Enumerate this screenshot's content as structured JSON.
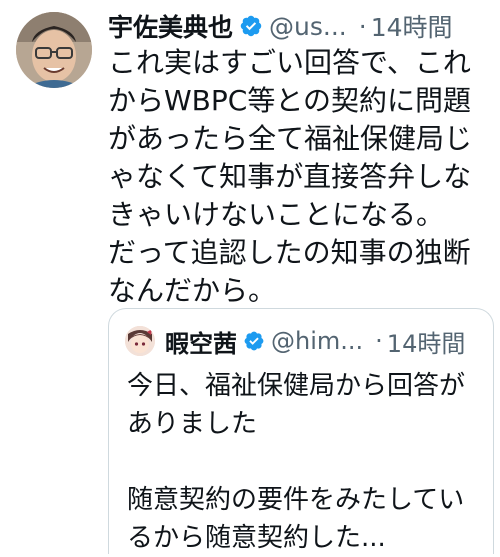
{
  "tweet": {
    "display_name": "宇佐美典也",
    "handle": "@us...",
    "separator": "·",
    "time": "14時間",
    "text": "これ実はすごい回答で、これからWBPC等との契約に問題があったら全て福祉保健局じゃなくて知事が直接答弁しなきゃいけないことになる。\nだって追認したの知事の独断なんだから。"
  },
  "quoted_tweet": {
    "display_name": "暇空茜",
    "handle": "@him...",
    "separator": "·",
    "time": "14時間",
    "text": "今日、福祉保健局から回答がありました\n\n随意契約の要件をみたしているから随意契約した..."
  },
  "icons": {
    "verified": "verified-badge-icon",
    "avatar": "avatar-photo",
    "quote_avatar": "avatar-illustration"
  },
  "colors": {
    "text": "#0f1419",
    "secondary_text": "#536471",
    "verified_blue": "#1d9bf0",
    "border": "#cfd9de"
  }
}
